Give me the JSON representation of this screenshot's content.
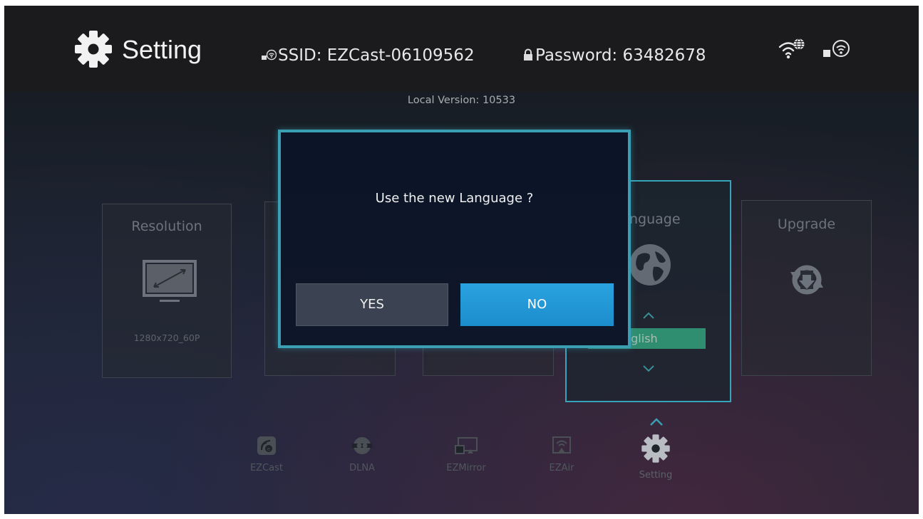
{
  "header": {
    "title": "Setting",
    "ssid_label": "SSID:",
    "ssid_value": "EZCast-06109562",
    "password_label": "Password:",
    "password_value": "63482678"
  },
  "version": {
    "label": "Local Version:",
    "value": "10533"
  },
  "cards": {
    "resolution": {
      "title": "Resolution",
      "value": "1280x720_60P"
    },
    "language": {
      "title": "nguage",
      "value": "nglish"
    },
    "upgrade": {
      "title": "Upgrade"
    }
  },
  "dialog": {
    "question": "Use the new Language ?",
    "yes_label": "YES",
    "no_label": "NO"
  },
  "bottom_nav": {
    "items": [
      {
        "label": "EZCast",
        "icon": "ezcast-icon"
      },
      {
        "label": "DLNA",
        "icon": "dlna-icon"
      },
      {
        "label": "EZMirror",
        "icon": "ezmirror-icon"
      },
      {
        "label": "EZAir",
        "icon": "ezair-icon"
      },
      {
        "label": "Setting",
        "icon": "gear-icon"
      }
    ],
    "selected": "Setting"
  },
  "colors": {
    "accent_border": "#3a9fb2",
    "no_button": "#1f95d3",
    "language_select": "#2f8e70"
  }
}
